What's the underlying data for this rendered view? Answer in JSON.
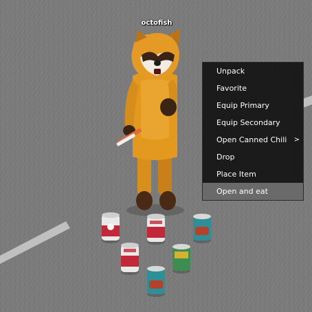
{
  "player": {
    "name": "octofish"
  },
  "context_menu": {
    "items": [
      {
        "label": "Unpack",
        "submenu": "",
        "highlighted": false
      },
      {
        "label": "Favorite",
        "submenu": "",
        "highlighted": false
      },
      {
        "label": "Equip Primary",
        "submenu": "",
        "highlighted": false
      },
      {
        "label": "Equip Secondary",
        "submenu": "",
        "highlighted": false
      },
      {
        "label": "Open Canned Chili",
        "submenu": ">",
        "highlighted": false
      },
      {
        "label": "Drop",
        "submenu": "",
        "highlighted": false
      },
      {
        "label": "Place Item",
        "submenu": "",
        "highlighted": false
      },
      {
        "label": "Open and eat",
        "submenu": "",
        "highlighted": true
      }
    ]
  },
  "world_items": [
    {
      "name": "tomato-soup-can",
      "color": "#e9e9e9",
      "label_color": "#c3283a"
    },
    {
      "name": "tomato-soup-can",
      "color": "#e9e9e9",
      "label_color": "#c3283a"
    },
    {
      "name": "beans-can",
      "color": "#2f8f96",
      "label_color": "#b6412a"
    },
    {
      "name": "tomato-soup-can",
      "color": "#e9e9e9",
      "label_color": "#c3283a"
    },
    {
      "name": "green-soup-can",
      "color": "#3c8d52",
      "label_color": "#d6b233"
    },
    {
      "name": "beans-can",
      "color": "#2f8f96",
      "label_color": "#b6412a"
    }
  ]
}
